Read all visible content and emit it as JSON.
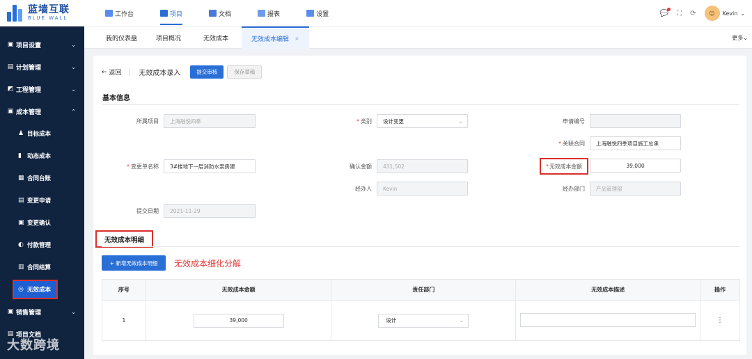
{
  "logo": {
    "cn": "蓝墙互联",
    "en": "BLUE WALL"
  },
  "topnav": [
    {
      "label": "工作台",
      "icon": "workbench-icon",
      "active": false
    },
    {
      "label": "项目",
      "icon": "project-icon",
      "active": true
    },
    {
      "label": "文档",
      "icon": "document-icon",
      "active": false
    },
    {
      "label": "报表",
      "icon": "report-icon",
      "active": false
    },
    {
      "label": "设置",
      "icon": "settings-icon",
      "active": false
    }
  ],
  "user": {
    "name": "Kevin"
  },
  "sidebar": {
    "items": [
      {
        "label": "项目设置",
        "icon": "▣",
        "chev": "⌄"
      },
      {
        "label": "计划管理",
        "icon": "▤",
        "chev": "⌄"
      },
      {
        "label": "工程管理",
        "icon": "◩",
        "chev": "⌄"
      },
      {
        "label": "成本管理",
        "icon": "▣",
        "chev": "⌃"
      }
    ],
    "subitems": [
      {
        "label": "目标成本",
        "icon": "♟"
      },
      {
        "label": "动态成本",
        "icon": "▮"
      },
      {
        "label": "合同台账",
        "icon": "▦"
      },
      {
        "label": "变更申请",
        "icon": "▤"
      },
      {
        "label": "变更确认",
        "icon": "▣"
      },
      {
        "label": "付款管理",
        "icon": "◐"
      },
      {
        "label": "合同结算",
        "icon": "▥"
      },
      {
        "label": "无效成本",
        "icon": "◎"
      }
    ],
    "bottom_items": [
      {
        "label": "销售管理",
        "icon": "▣",
        "chev": "⌄"
      },
      {
        "label": "项目文档",
        "icon": "▤",
        "chev": ""
      }
    ]
  },
  "tabs": {
    "items": [
      "我的仪表盘",
      "项目概况",
      "无效成本",
      "无效成本编辑"
    ],
    "more": "更多"
  },
  "toolbar": {
    "back": "返回",
    "title": "无效成本录入",
    "submit": "提交审核",
    "save": "保存草稿"
  },
  "basic": {
    "title": "基本信息",
    "project_label": "所属项目",
    "project_value": "上海融悦四季",
    "category_label": "类别",
    "category_value": "设计变更",
    "apply_no_label": "申请编号",
    "apply_no_value": "",
    "contract_label": "关联合同",
    "contract_value": "上海融悦四季项目施工总承",
    "change_name_label": "变更单名称",
    "change_name_value": "3#楼地下一层消防水泵房建",
    "confirm_amount_label": "确认金额",
    "confirm_amount_value": "431,502",
    "invalid_amount_label": "无效成本金额",
    "invalid_amount_value": "39,000",
    "handler_label": "经办人",
    "handler_value": "Kevin",
    "dept_label": "经办部门",
    "dept_value": "产品管理部",
    "submit_date_label": "提交日期",
    "submit_date_value": "2021-11-29"
  },
  "detail": {
    "title": "无效成本明细",
    "add_button": "+ 新增无效成本明细",
    "note": "无效成本细化分解",
    "columns": [
      "序号",
      "无效成本金额",
      "责任部门",
      "无效成本描述",
      "操作"
    ],
    "rows": [
      {
        "index": "1",
        "amount": "39,000",
        "dept": "设计",
        "desc": "",
        "action": "⋮"
      }
    ]
  },
  "watermark": "大数跨境"
}
